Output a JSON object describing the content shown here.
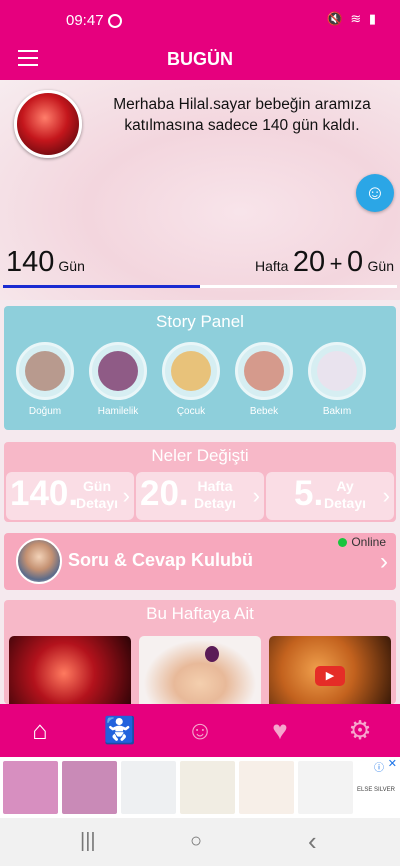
{
  "status_bar": {
    "time": "09:47",
    "icons": "🔇 ≋ ▮"
  },
  "app_bar": {
    "title": "BUGÜN"
  },
  "hero": {
    "welcome": "Merhaba Hilal.sayar bebeğin aramıza katılmasına sadece 140 gün kaldı.",
    "days_left_number": "140",
    "days_left_unit": "Gün",
    "week_label": "Hafta",
    "week_number": "20",
    "plus": "+",
    "day_number": "0",
    "day_unit": "Gün",
    "progress_percent": 50
  },
  "story_panel": {
    "title": "Story Panel",
    "items": [
      {
        "label": "Doğum",
        "color": "#b89a8e"
      },
      {
        "label": "Hamilelik",
        "color": "#8f5b86"
      },
      {
        "label": "Çocuk",
        "color": "#e8c27a"
      },
      {
        "label": "Bebek",
        "color": "#d59a8c"
      },
      {
        "label": "Bakım",
        "color": "#e9e3ee"
      }
    ]
  },
  "changes": {
    "title": "Neler Değişti",
    "items": [
      {
        "number": "140.",
        "line1": "Gün",
        "line2": "Detayı"
      },
      {
        "number": "20.",
        "line1": "Hafta",
        "line2": "Detayı"
      },
      {
        "number": "5.",
        "line1": "Ay",
        "line2": "Detayı"
      }
    ]
  },
  "club": {
    "title": "Soru & Cevap Kulubü",
    "status": "Online"
  },
  "this_week": {
    "title": "Bu Haftaya Ait",
    "video_label": "▶"
  },
  "bottom_nav": {
    "items": [
      {
        "icon": "home-icon",
        "glyph": "⌂"
      },
      {
        "icon": "mother-stroller-icon",
        "glyph": "🚼"
      },
      {
        "icon": "baby-icon",
        "glyph": "☺"
      },
      {
        "icon": "heartbeat-icon",
        "glyph": "♥"
      },
      {
        "icon": "settings-icon",
        "glyph": "⚙"
      }
    ]
  },
  "ad": {
    "brand": "ELSE SILVER",
    "info": "ⓘ",
    "close": "✕"
  },
  "system_nav": {
    "recents": "|||",
    "home": "○",
    "back": "‹"
  },
  "colors": {
    "brand": "#e6007e",
    "story_panel": "#8ecfdb",
    "pink_card": "#f7b8c8",
    "progress": "#1a2bd1"
  }
}
